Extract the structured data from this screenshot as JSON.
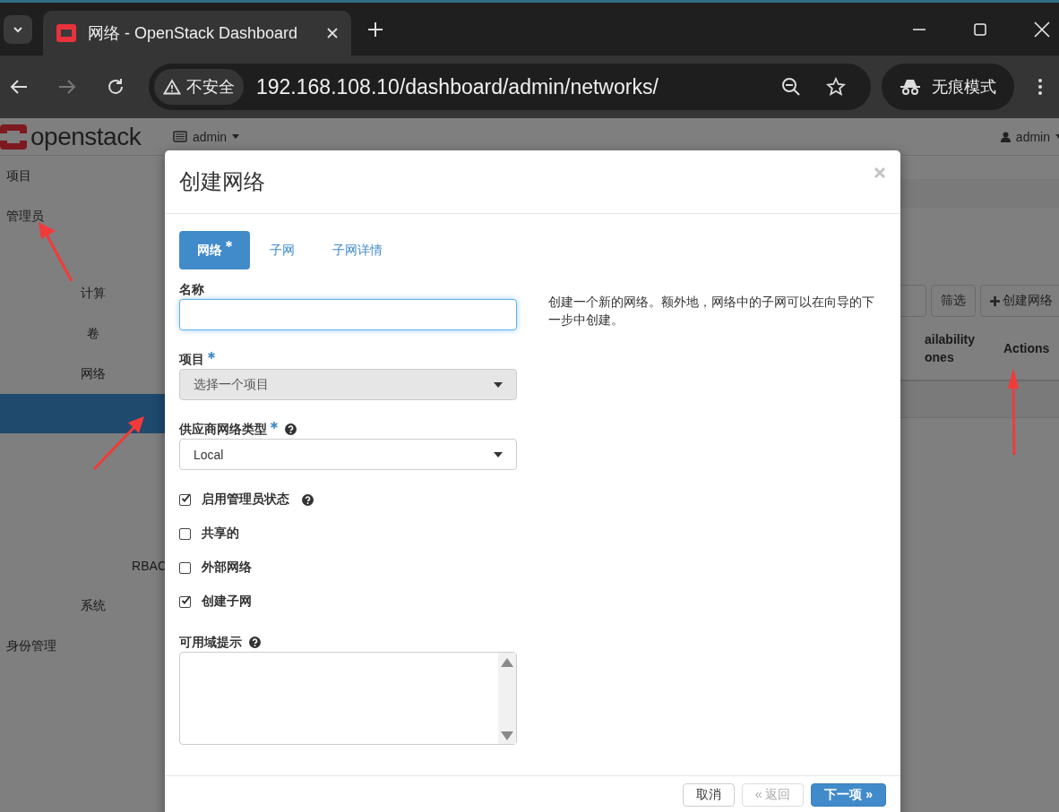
{
  "browser": {
    "tab_title": "网络 - OpenStack Dashboard",
    "security_label": "不安全",
    "url": "192.168.108.10/dashboard/admin/networks/",
    "incognito_label": "无痕模式"
  },
  "header": {
    "logo": "openstack",
    "project_menu": "admin",
    "user_menu": "admin"
  },
  "sidebar": {
    "items": [
      {
        "label": "项目",
        "kind": "section"
      },
      {
        "label": "管理员",
        "kind": "section"
      },
      {
        "label": "计算",
        "kind": "panel"
      },
      {
        "label": "卷",
        "kind": "panel"
      },
      {
        "label": "网络",
        "kind": "panel"
      },
      {
        "kind": "highlight"
      },
      {
        "label": "RBAC",
        "kind": "subpanel"
      },
      {
        "label": "系统",
        "kind": "panel"
      },
      {
        "label": "身份管理",
        "kind": "section"
      }
    ]
  },
  "toolbar": {
    "buttons": [
      {
        "label": "筛选",
        "kind": "plain"
      },
      {
        "label": "创建网络",
        "kind": "add"
      }
    ]
  },
  "table": {
    "columns": [
      "ailability ones",
      "Actions"
    ]
  },
  "modal": {
    "title": "创建网络",
    "tabs": [
      {
        "label": "网络",
        "required": true,
        "selected": true
      },
      {
        "label": "子网",
        "required": false,
        "selected": false
      },
      {
        "label": "子网详情",
        "required": false,
        "selected": false
      }
    ],
    "fields": [
      {
        "kind": "text",
        "label": "名称",
        "required": false,
        "help": false,
        "focused": true
      },
      {
        "kind": "select",
        "label": "项目",
        "required": true,
        "help": false,
        "value": "选择一个项目",
        "disabled": true
      },
      {
        "kind": "select",
        "label": "供应商网络类型",
        "required": true,
        "help": true,
        "value": "Local",
        "disabled": false
      },
      {
        "kind": "checkbox",
        "label": "启用管理员状态",
        "checked": true,
        "help": true
      },
      {
        "kind": "checkbox",
        "label": "共享的",
        "checked": false,
        "help": false
      },
      {
        "kind": "checkbox",
        "label": "外部网络",
        "checked": false,
        "help": false
      },
      {
        "kind": "checkbox",
        "label": "创建子网",
        "checked": true,
        "help": false
      },
      {
        "kind": "textarea",
        "label": "可用域提示",
        "required": false,
        "help": true
      }
    ],
    "description": "创建一个新的网络。额外地，网络中的子网可以在向导的下一步中创建。",
    "buttons": [
      {
        "label": "取消",
        "kind": "default"
      },
      {
        "label": "« 返回",
        "kind": "disabled"
      },
      {
        "label": "下一项 »",
        "kind": "primary"
      }
    ]
  }
}
